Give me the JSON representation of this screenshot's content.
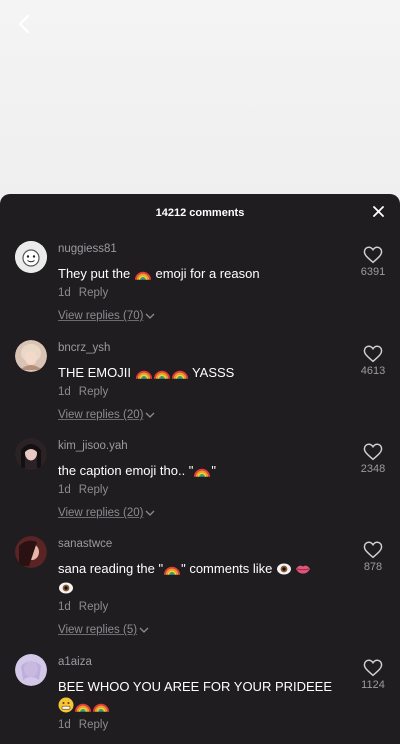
{
  "header": {
    "comment_count": "14212 comments"
  },
  "comments": [
    {
      "username": "nuggiess81",
      "text_a": "They put the ",
      "text_b": " emoji for a reason",
      "time": "1d",
      "reply_label": "Reply",
      "view_replies": "View replies (70)",
      "likes": "6391",
      "avatar_color": "#e8e8e8"
    },
    {
      "username": "bncrz_ysh",
      "text_a": "THE EMOJII ",
      "text_b": " YASSS",
      "time": "1d",
      "reply_label": "Reply",
      "view_replies": "View replies (20)",
      "likes": "4613",
      "avatar_color": "#c9a89a"
    },
    {
      "username": "kim_jisoo.yah",
      "text_a": "the caption emoji tho.. \"",
      "text_b": "\"",
      "time": "1d",
      "reply_label": "Reply",
      "view_replies": "View replies (20)",
      "likes": "2348",
      "avatar_color": "#3a2f33"
    },
    {
      "username": "sanastwce",
      "text_a": "sana reading the \"",
      "text_b": "\" comments like ",
      "time": "1d",
      "reply_label": "Reply",
      "view_replies": "View replies (5)",
      "likes": "878",
      "avatar_color": "#7a3a3a"
    },
    {
      "username": "a1aiza",
      "text_a": "BEE WHOO YOU AREE FOR YOUR PRIDEEE",
      "time": "1d",
      "reply_label": "Reply",
      "likes": "1124",
      "avatar_color": "#c7b9e0"
    }
  ],
  "icons": {
    "back": "chevron-left-icon",
    "close": "close-icon",
    "like": "heart-outline-icon",
    "rainbow": "rainbow-emoji",
    "eye": "eye-emoji",
    "lips": "lips-emoji",
    "face": "grimacing-face-emoji"
  }
}
